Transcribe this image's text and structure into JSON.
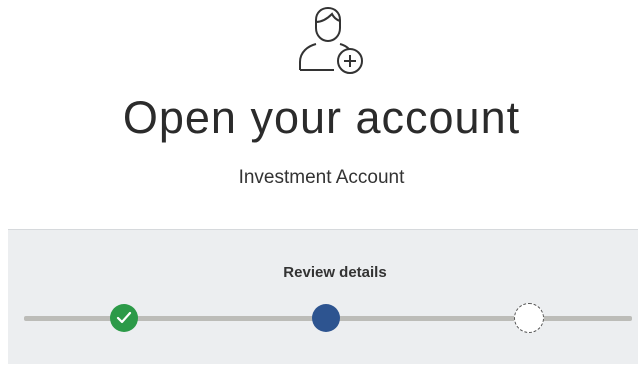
{
  "header": {
    "icon": "add-user-icon",
    "title": "Open your account",
    "subtitle": "Investment Account"
  },
  "stepper": {
    "current_step_label": "Review details",
    "steps": [
      {
        "state": "complete",
        "icon": "checkmark-icon",
        "color": "#2c9a48"
      },
      {
        "state": "current",
        "color": "#2d5490"
      },
      {
        "state": "upcoming",
        "style": "dashed"
      }
    ],
    "track_color": "#bcbcb8",
    "panel_color": "#eceef0"
  }
}
